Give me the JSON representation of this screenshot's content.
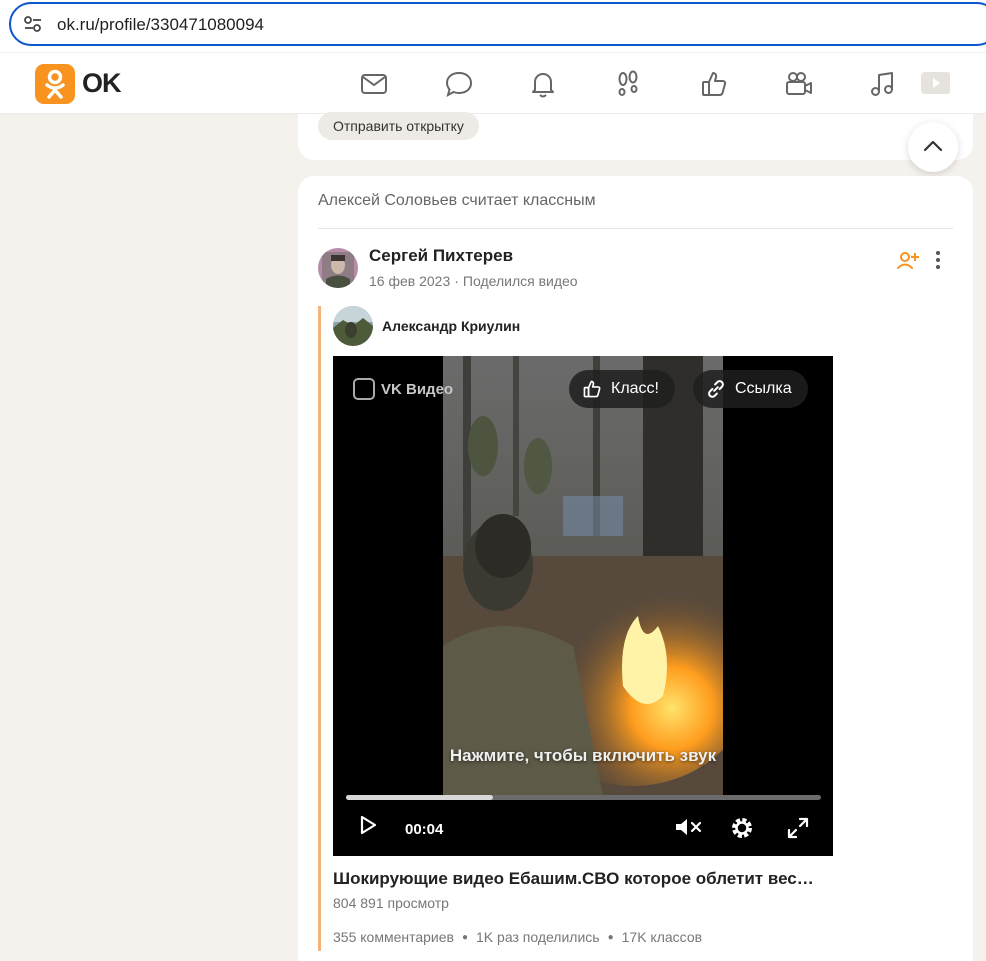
{
  "browser": {
    "url": "ok.ru/profile/330471080094"
  },
  "header": {
    "brand": "OK",
    "accent": "#f7931e",
    "nav_icons": [
      "mail-icon",
      "chat-icon",
      "bell-icon",
      "footprints-icon",
      "like-icon",
      "video-camera-icon",
      "music-icon",
      "video-play-icon"
    ]
  },
  "top_card": {
    "postcard_label": "Отправить открытку"
  },
  "feed": {
    "header": "Алексей Соловьев считает классным",
    "post": {
      "author": "Сергей Пихтерев",
      "date": "16 фев 2023",
      "meta_dot": "·",
      "action": "Поделился видео",
      "repost_author": "Александр Криулин",
      "video": {
        "provider": "VK Видео",
        "class_label": "Класс!",
        "link_label": "Ссылка",
        "sound_hint": "Нажмите, чтобы включить звук",
        "time": "00:04",
        "progress": 0.31
      },
      "video_title": "Шокирующие видео Ебашим.СВО которое облетит вес…",
      "views": "804 891 просмотр",
      "stats": {
        "comments": "355 комментариев",
        "shares": "1K раз поделились",
        "classes": "17K классов",
        "separator": "●"
      }
    }
  }
}
